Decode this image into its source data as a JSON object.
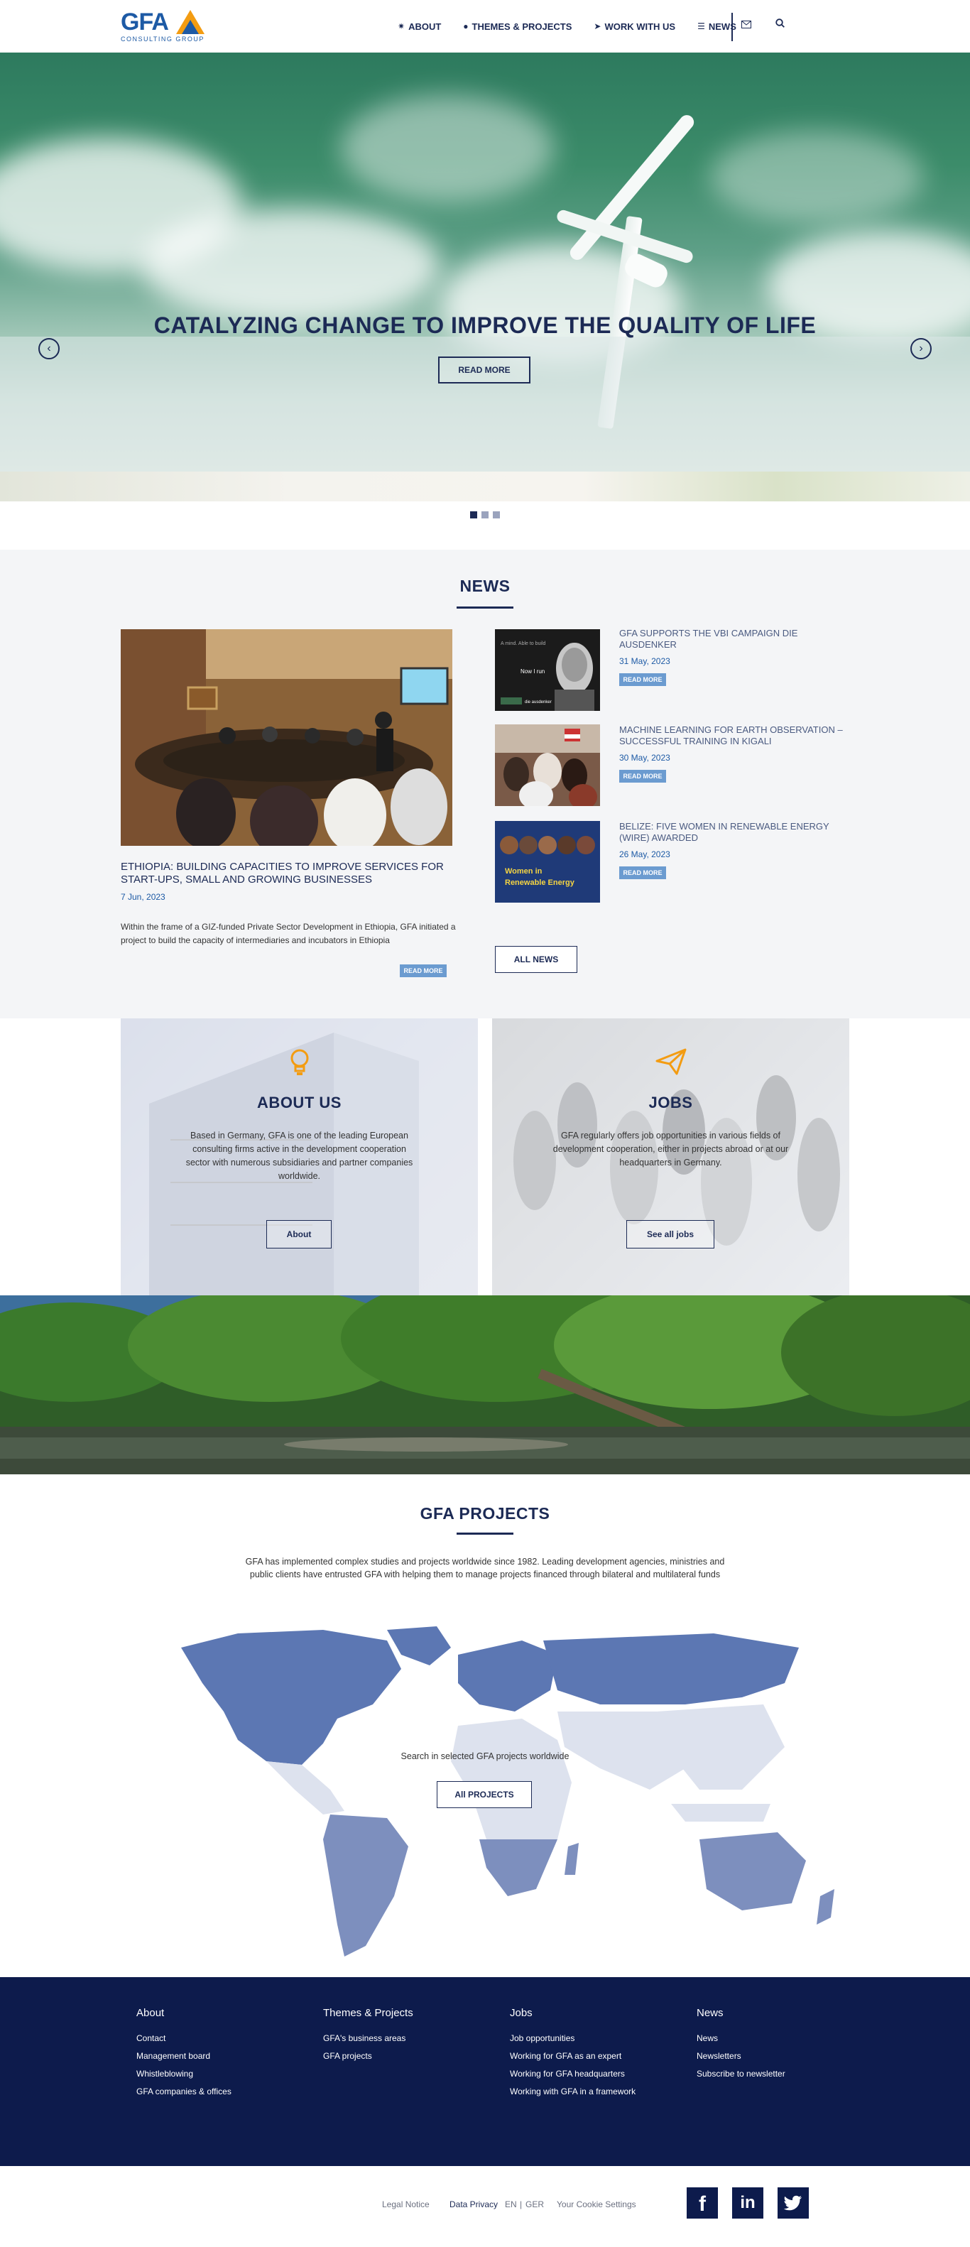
{
  "header": {
    "logo_text": "GFA",
    "logo_sub": "CONSULTING GROUP",
    "nav": [
      {
        "icon": "bulb-icon",
        "glyph": "✷",
        "label": "ABOUT"
      },
      {
        "icon": "globe-icon",
        "glyph": "●",
        "label": "THEMES & PROJECTS"
      },
      {
        "icon": "paper-plane-icon",
        "glyph": "➤",
        "label": "WORK WITH US"
      },
      {
        "icon": "newspaper-icon",
        "glyph": "☰",
        "label": "NEWS"
      }
    ]
  },
  "hero": {
    "title": "CATALYZING CHANGE TO IMPROVE THE QUALITY OF LIFE",
    "button": "READ MORE",
    "slides": 3
  },
  "news": {
    "title": "NEWS",
    "main": {
      "title": "ETHIOPIA: BUILDING CAPACITIES TO IMPROVE SERVICES FOR START-UPS, SMALL AND GROWING BUSINESSES",
      "date": "7 Jun, 2023",
      "text": "Within the frame of a GIZ-funded Private Sector Development in Ethiopia, GFA initiated a project to build the capacity of intermediaries and incubators in Ethiopia",
      "button": "READ MORE"
    },
    "side": [
      {
        "title": "GFA SUPPORTS THE VBI CAMPAIGN DIE AUSDENKER",
        "date": "31 May, 2023",
        "button": "READ MORE",
        "img_text_1": "A mind. Able to build",
        "img_text_2": "Now I run",
        "img_text_3": "die ausdenker"
      },
      {
        "title": "MACHINE LEARNING FOR EARTH OBSERVATION – SUCCESSFUL TRAINING IN KIGALI",
        "date": "30 May, 2023",
        "button": "READ MORE"
      },
      {
        "title": "BELIZE: FIVE WOMEN IN RENEWABLE ENERGY (WIRE) AWARDED",
        "date": "26 May, 2023",
        "button": "READ MORE",
        "img_text_1": "Women in",
        "img_text_2": "Renewable Energy"
      }
    ],
    "all_button": "ALL NEWS"
  },
  "about": {
    "title": "ABOUT US",
    "text": "Based in Germany, GFA is one of the leading European consulting firms active in the development cooperation sector with numerous subsidiaries and partner companies worldwide.",
    "button": "About"
  },
  "jobs": {
    "title": "JOBS",
    "text": "GFA regularly offers job opportunities in various fields of development cooperation, either in projects abroad or at our headquarters in Germany.",
    "button": "See all jobs"
  },
  "projects": {
    "title": "GFA PROJECTS",
    "text": "GFA has implemented complex studies and projects worldwide since 1982. Leading development agencies, ministries and public clients have entrusted GFA with helping them to manage projects financed through bilateral and multilateral funds",
    "search_text": "Search in selected GFA projects worldwide",
    "button": "All PROJECTS"
  },
  "footer": {
    "columns": [
      {
        "head": "About",
        "links": [
          "Contact",
          "Management board",
          "Whistleblowing",
          "GFA companies & offices"
        ]
      },
      {
        "head": "Themes & Projects",
        "links": [
          "GFA's business areas",
          "GFA projects"
        ]
      },
      {
        "head": "Jobs",
        "links": [
          "Job opportunities",
          "Working for GFA as an expert",
          "Working for GFA headquarters",
          "Working with GFA in a framework"
        ]
      },
      {
        "head": "News",
        "links": [
          "News",
          "Newsletters",
          "Subscribe to newsletter"
        ]
      }
    ],
    "bottom": {
      "legal": "Legal Notice",
      "privacy": "Data Privacy",
      "en": "EN",
      "sep": "|",
      "ger": "GER",
      "cookies": "Your Cookie Settings"
    },
    "social": [
      {
        "icon": "facebook-icon",
        "glyph": "f"
      },
      {
        "icon": "linkedin-icon",
        "glyph": "in"
      },
      {
        "icon": "twitter-icon",
        "glyph": "t"
      }
    ]
  },
  "colors": {
    "navy": "#1c2a55",
    "accent": "#f39c12",
    "link_blue": "#1d5aa5",
    "footer": "#0d1b4c",
    "button_blue": "#6b9bd0"
  }
}
